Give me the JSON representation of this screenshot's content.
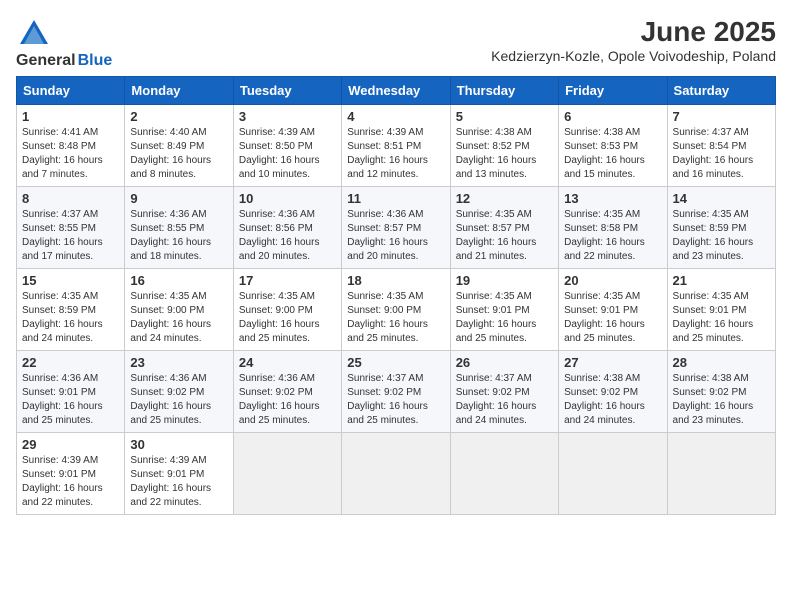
{
  "logo": {
    "general": "General",
    "blue": "Blue"
  },
  "title": "June 2025",
  "subtitle": "Kedzierzyn-Kozle, Opole Voivodeship, Poland",
  "headers": [
    "Sunday",
    "Monday",
    "Tuesday",
    "Wednesday",
    "Thursday",
    "Friday",
    "Saturday"
  ],
  "weeks": [
    [
      {
        "day": "1",
        "info": "Sunrise: 4:41 AM\nSunset: 8:48 PM\nDaylight: 16 hours\nand 7 minutes."
      },
      {
        "day": "2",
        "info": "Sunrise: 4:40 AM\nSunset: 8:49 PM\nDaylight: 16 hours\nand 8 minutes."
      },
      {
        "day": "3",
        "info": "Sunrise: 4:39 AM\nSunset: 8:50 PM\nDaylight: 16 hours\nand 10 minutes."
      },
      {
        "day": "4",
        "info": "Sunrise: 4:39 AM\nSunset: 8:51 PM\nDaylight: 16 hours\nand 12 minutes."
      },
      {
        "day": "5",
        "info": "Sunrise: 4:38 AM\nSunset: 8:52 PM\nDaylight: 16 hours\nand 13 minutes."
      },
      {
        "day": "6",
        "info": "Sunrise: 4:38 AM\nSunset: 8:53 PM\nDaylight: 16 hours\nand 15 minutes."
      },
      {
        "day": "7",
        "info": "Sunrise: 4:37 AM\nSunset: 8:54 PM\nDaylight: 16 hours\nand 16 minutes."
      }
    ],
    [
      {
        "day": "8",
        "info": "Sunrise: 4:37 AM\nSunset: 8:55 PM\nDaylight: 16 hours\nand 17 minutes."
      },
      {
        "day": "9",
        "info": "Sunrise: 4:36 AM\nSunset: 8:55 PM\nDaylight: 16 hours\nand 18 minutes."
      },
      {
        "day": "10",
        "info": "Sunrise: 4:36 AM\nSunset: 8:56 PM\nDaylight: 16 hours\nand 20 minutes."
      },
      {
        "day": "11",
        "info": "Sunrise: 4:36 AM\nSunset: 8:57 PM\nDaylight: 16 hours\nand 20 minutes."
      },
      {
        "day": "12",
        "info": "Sunrise: 4:35 AM\nSunset: 8:57 PM\nDaylight: 16 hours\nand 21 minutes."
      },
      {
        "day": "13",
        "info": "Sunrise: 4:35 AM\nSunset: 8:58 PM\nDaylight: 16 hours\nand 22 minutes."
      },
      {
        "day": "14",
        "info": "Sunrise: 4:35 AM\nSunset: 8:59 PM\nDaylight: 16 hours\nand 23 minutes."
      }
    ],
    [
      {
        "day": "15",
        "info": "Sunrise: 4:35 AM\nSunset: 8:59 PM\nDaylight: 16 hours\nand 24 minutes."
      },
      {
        "day": "16",
        "info": "Sunrise: 4:35 AM\nSunset: 9:00 PM\nDaylight: 16 hours\nand 24 minutes."
      },
      {
        "day": "17",
        "info": "Sunrise: 4:35 AM\nSunset: 9:00 PM\nDaylight: 16 hours\nand 25 minutes."
      },
      {
        "day": "18",
        "info": "Sunrise: 4:35 AM\nSunset: 9:00 PM\nDaylight: 16 hours\nand 25 minutes."
      },
      {
        "day": "19",
        "info": "Sunrise: 4:35 AM\nSunset: 9:01 PM\nDaylight: 16 hours\nand 25 minutes."
      },
      {
        "day": "20",
        "info": "Sunrise: 4:35 AM\nSunset: 9:01 PM\nDaylight: 16 hours\nand 25 minutes."
      },
      {
        "day": "21",
        "info": "Sunrise: 4:35 AM\nSunset: 9:01 PM\nDaylight: 16 hours\nand 25 minutes."
      }
    ],
    [
      {
        "day": "22",
        "info": "Sunrise: 4:36 AM\nSunset: 9:01 PM\nDaylight: 16 hours\nand 25 minutes."
      },
      {
        "day": "23",
        "info": "Sunrise: 4:36 AM\nSunset: 9:02 PM\nDaylight: 16 hours\nand 25 minutes."
      },
      {
        "day": "24",
        "info": "Sunrise: 4:36 AM\nSunset: 9:02 PM\nDaylight: 16 hours\nand 25 minutes."
      },
      {
        "day": "25",
        "info": "Sunrise: 4:37 AM\nSunset: 9:02 PM\nDaylight: 16 hours\nand 25 minutes."
      },
      {
        "day": "26",
        "info": "Sunrise: 4:37 AM\nSunset: 9:02 PM\nDaylight: 16 hours\nand 24 minutes."
      },
      {
        "day": "27",
        "info": "Sunrise: 4:38 AM\nSunset: 9:02 PM\nDaylight: 16 hours\nand 24 minutes."
      },
      {
        "day": "28",
        "info": "Sunrise: 4:38 AM\nSunset: 9:02 PM\nDaylight: 16 hours\nand 23 minutes."
      }
    ],
    [
      {
        "day": "29",
        "info": "Sunrise: 4:39 AM\nSunset: 9:01 PM\nDaylight: 16 hours\nand 22 minutes."
      },
      {
        "day": "30",
        "info": "Sunrise: 4:39 AM\nSunset: 9:01 PM\nDaylight: 16 hours\nand 22 minutes."
      },
      {
        "day": "",
        "info": ""
      },
      {
        "day": "",
        "info": ""
      },
      {
        "day": "",
        "info": ""
      },
      {
        "day": "",
        "info": ""
      },
      {
        "day": "",
        "info": ""
      }
    ]
  ]
}
